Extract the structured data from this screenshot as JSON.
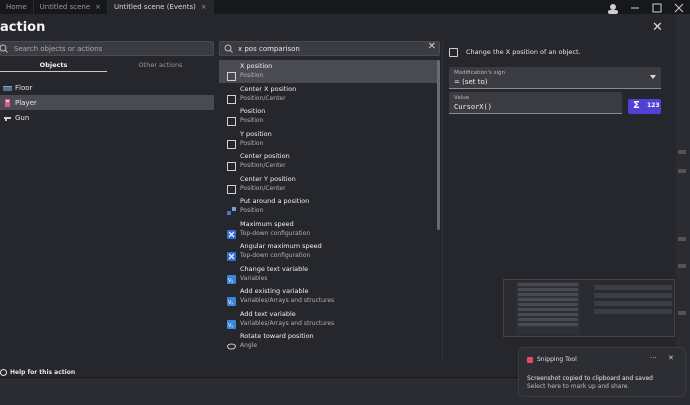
{
  "tabs": [
    {
      "label": "Home",
      "active": false,
      "closable": false
    },
    {
      "label": "Untitled scene",
      "active": false,
      "closable": true
    },
    {
      "label": "Untitled scene (Events)",
      "active": true,
      "closable": true
    }
  ],
  "dialog": {
    "title": "action",
    "close_icon": "close-icon"
  },
  "left": {
    "search_placeholder": "Search objects or actions",
    "tabs": [
      {
        "label": "Objects",
        "active": true
      },
      {
        "label": "Other actions",
        "active": false
      }
    ],
    "objects": [
      {
        "label": "Floor",
        "icon": "tiled-sprite-icon",
        "selected": false
      },
      {
        "label": "Player",
        "icon": "sprite-object-icon",
        "selected": true
      },
      {
        "label": "Gun",
        "icon": "gun-sprite-icon",
        "selected": false
      }
    ]
  },
  "middle": {
    "search_value": "x pos comparison",
    "clear_icon": "clear-icon",
    "results": [
      {
        "title": "X position",
        "subtitle": "Position",
        "icon": "checkbox-icon",
        "selected": true
      },
      {
        "title": "Center X position",
        "subtitle": "Position/Center",
        "icon": "checkbox-icon",
        "selected": false
      },
      {
        "title": "Position",
        "subtitle": "Position",
        "icon": "checkbox-icon",
        "selected": false
      },
      {
        "title": "Y position",
        "subtitle": "Position",
        "icon": "checkbox-icon",
        "selected": false
      },
      {
        "title": "Center position",
        "subtitle": "Position/Center",
        "icon": "checkbox-icon",
        "selected": false
      },
      {
        "title": "Center Y position",
        "subtitle": "Position/Center",
        "icon": "checkbox-icon",
        "selected": false
      },
      {
        "title": "Put around a position",
        "subtitle": "Position",
        "icon": "put-around-icon",
        "selected": false
      },
      {
        "title": "Maximum speed",
        "subtitle": "Top-down configuration",
        "icon": "topdown-icon",
        "selected": false
      },
      {
        "title": "Angular maximum speed",
        "subtitle": "Top-down configuration",
        "icon": "topdown-icon",
        "selected": false
      },
      {
        "title": "Change text variable",
        "subtitle": "Variables",
        "icon": "variable-icon",
        "selected": false
      },
      {
        "title": "Add existing variable",
        "subtitle": "Variables/Arrays and structures",
        "icon": "variable-icon",
        "selected": false
      },
      {
        "title": "Add text variable",
        "subtitle": "Variables/Arrays and structures",
        "icon": "variable-icon",
        "selected": false
      },
      {
        "title": "Rotate toward position",
        "subtitle": "Angle",
        "icon": "rotate-icon",
        "selected": false
      }
    ]
  },
  "right": {
    "description": "Change the X position of an object.",
    "modification_sign": {
      "label": "Modification's sign",
      "value": "= (set to)"
    },
    "value_field": {
      "label": "Value",
      "value": "CursorX()"
    },
    "expression_button": {
      "sigma": "Σ",
      "number": "123"
    }
  },
  "footer": {
    "help_label": "Help for this action"
  },
  "notification": {
    "app_name": "Snipping Tool",
    "message_line1": "Screenshot copied to clipboard and saved",
    "message_line2": "Select here to mark up and share.",
    "more_icon": "more-icon",
    "close_icon": "close-icon"
  },
  "colors": {
    "accent": "#5142d6",
    "dialog_bg": "#26272c",
    "selected_row": "#4a4b52"
  }
}
